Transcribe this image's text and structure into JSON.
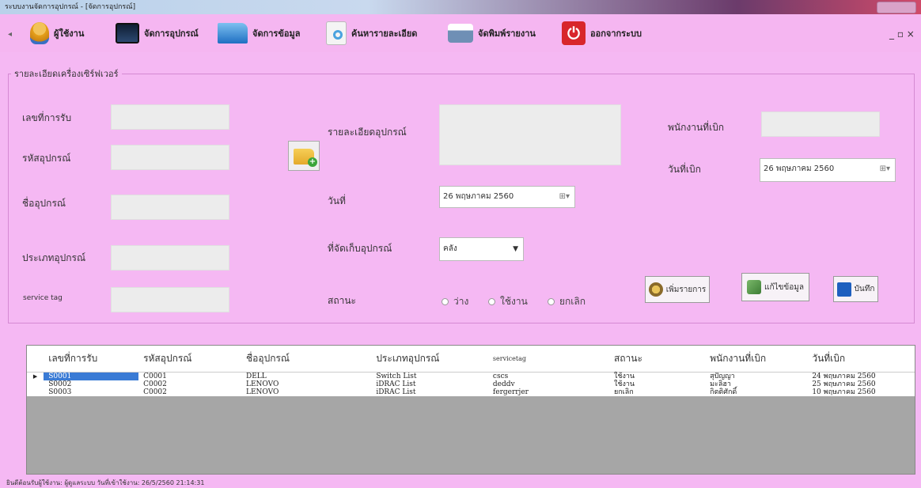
{
  "window": {
    "title": "ระบบงานจัดการอุปกรณ์ - [จัดการอุปกรณ์]"
  },
  "menu": {
    "items": [
      {
        "label": "ผู้ใช้งาน",
        "icon": "user-icon",
        "color": "#e7a11a"
      },
      {
        "label": "จัดการอุปกรณ์",
        "icon": "monitor-icon",
        "color": "#1f3a5f"
      },
      {
        "label": "จัดการข้อมูล",
        "icon": "folder-icon",
        "color": "#3a8fd6"
      },
      {
        "label": "ค้นหารายละเอียด",
        "icon": "search-icon",
        "color": "#62b6e6"
      },
      {
        "label": "จัดพิมพ์รายงาน",
        "icon": "printer-icon",
        "color": "#5a7fa8"
      },
      {
        "label": "ออกจากระบบ",
        "icon": "power-icon",
        "color": "#d8262b"
      }
    ],
    "window_controls": "_ ▫ ×"
  },
  "form": {
    "group_title": "รายละเอียดเครื่องเซิร์ฟเวอร์",
    "labels": {
      "receive_no": "เลขที่การรับ",
      "device_code": "รหัสอุปกรณ์",
      "device_name": "ชื่ออุปกรณ์",
      "device_type": "ประเภทอุปกรณ์",
      "service_tag": "service tag",
      "device_detail": "รายละเอียดอุปกรณ์",
      "date": "วันที่",
      "storage": "ที่จัดเก็บอุปกรณ์",
      "status": "สถานะ",
      "issuer": "พนักงานที่เบิก",
      "issue_date": "วันที่เบิก"
    },
    "date_value": "26 พฤษภาคม  2560",
    "issue_date_value": "26 พฤษภาคม  2560",
    "storage_value": "คลัง",
    "status_options": [
      "ว่าง",
      "ใช้งาน",
      "ยกเลิก"
    ],
    "buttons": {
      "add": "เพิ่มรายการ",
      "edit": "แก้ไขข้อมูล",
      "save": "บันทึก"
    }
  },
  "grid": {
    "columns": [
      "เลขที่การรับ",
      "รหัสอุปกรณ์",
      "ชื่ออุปกรณ์",
      "ประเภทอุปกรณ์",
      "servicetag",
      "สถานะ",
      "พนักงานที่เบิก",
      "วันที่เบิก"
    ],
    "rows": [
      [
        "S0001",
        "C0001",
        "DELL",
        "Switch List",
        "cscs",
        "ใช้งาน",
        "สุปัญญา",
        "24 พฤษภาคม 2560"
      ],
      [
        "S0002",
        "C0002",
        "LENOVO",
        "iDRAC List",
        "deddv",
        "ใช้งาน",
        "มะลิฮา",
        "25 พฤษภาคม 2560"
      ],
      [
        "S0003",
        "C0002",
        "LENOVO",
        "iDRAC List",
        "fergerrjer",
        "ยกเลิก",
        "กิตติศักดิ์",
        "10 พฤษภาคม 2560"
      ]
    ],
    "selected_row": 0
  },
  "status_bar": {
    "text": "ยินดีต้อนรับผู้ใช้งาน: ผู้ดูแลระบบ  วันที่เข้าใช้งาน: 26/5/2560 21:14:31"
  },
  "colors": {
    "background": "#f5b8f3",
    "selection": "#3a7bd5"
  }
}
